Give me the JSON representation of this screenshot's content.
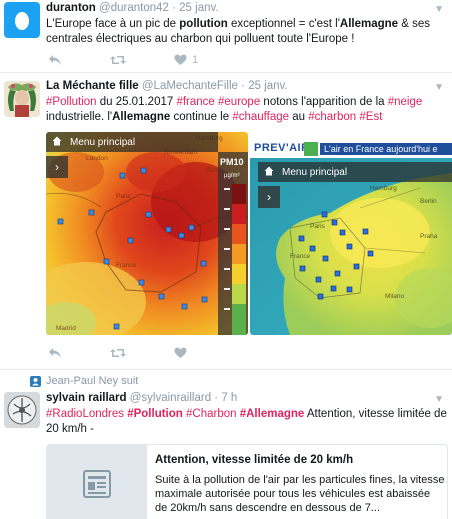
{
  "colors": {
    "hashtag": "#e0245e",
    "meta": "#8899a6",
    "action": "#aab8c2",
    "link": "#1da1f2"
  },
  "tweet1": {
    "name": "duranton",
    "handle": "@duranton42",
    "sep": "·",
    "date": "25 janv.",
    "text_a": "L'Europe face à un pic de ",
    "text_b": "pollution",
    "text_c": " exceptionnel = c'est l'",
    "text_d": "Allemagne",
    "text_e": " & ses centrales électriques au charbon qui polluent toute l'Europe !",
    "like_count": "1",
    "icons": [
      "egg-avatar",
      "reply-icon",
      "retweet-icon",
      "like-icon",
      "caret-down-icon"
    ]
  },
  "tweet2": {
    "name": "La Méchante fille",
    "handle": "@LaMechanteFille",
    "sep": "·",
    "date": "25 janv.",
    "t1": "#Pollution",
    "t2": " du 25.01.2017 ",
    "t3": "#france",
    "t4": " ",
    "t5": "#europe",
    "t6": " notons l'apparition de la ",
    "t7": "#neige",
    "t8": " industrielle. l'",
    "t9": "Allemagne",
    "t10": " continue le ",
    "t11": "#chauffage",
    "t12": " au ",
    "t13": "#charbon",
    "t14": " ",
    "t15": "#Est",
    "map1": {
      "menu_label": "Menu principal",
      "legend_title": "PM10",
      "legend_unit": "µg/m³",
      "cities": [
        "London",
        "Amsterdam",
        "Hamburg",
        "Berlin",
        "Paris",
        "France",
        "Madrid"
      ]
    },
    "map2": {
      "brand": "PREV'AIR",
      "tagline": "L'air en France aujourd'hui e",
      "menu_label": "Menu principal",
      "cities": [
        "Hamburg",
        "Berlin",
        "Praha",
        "Paris",
        "France",
        "Milano"
      ]
    }
  },
  "follow_notice": "Jean-Paul Ney suit",
  "tweet3": {
    "name": "sylvain raillard",
    "handle": "@sylvainraillard",
    "sep": "·",
    "date": "7 h",
    "t1": "#RadioLondres",
    "t2": " ",
    "t3": "#Pollution",
    "t4": " ",
    "t5": "#Charbon",
    "t6": " ",
    "t7": "#Allemagne",
    "t8": "  Attention, vitesse limitée de 20 km/h -",
    "card_title": "Attention, vitesse limitée de 20 km/h",
    "card_desc": "Suite à la pollution de l'air par les particules fines, la vitesse maximale autorisée pour tous les véhicules est abaissée de 20km/h sans descendre en dessous de 7..."
  }
}
